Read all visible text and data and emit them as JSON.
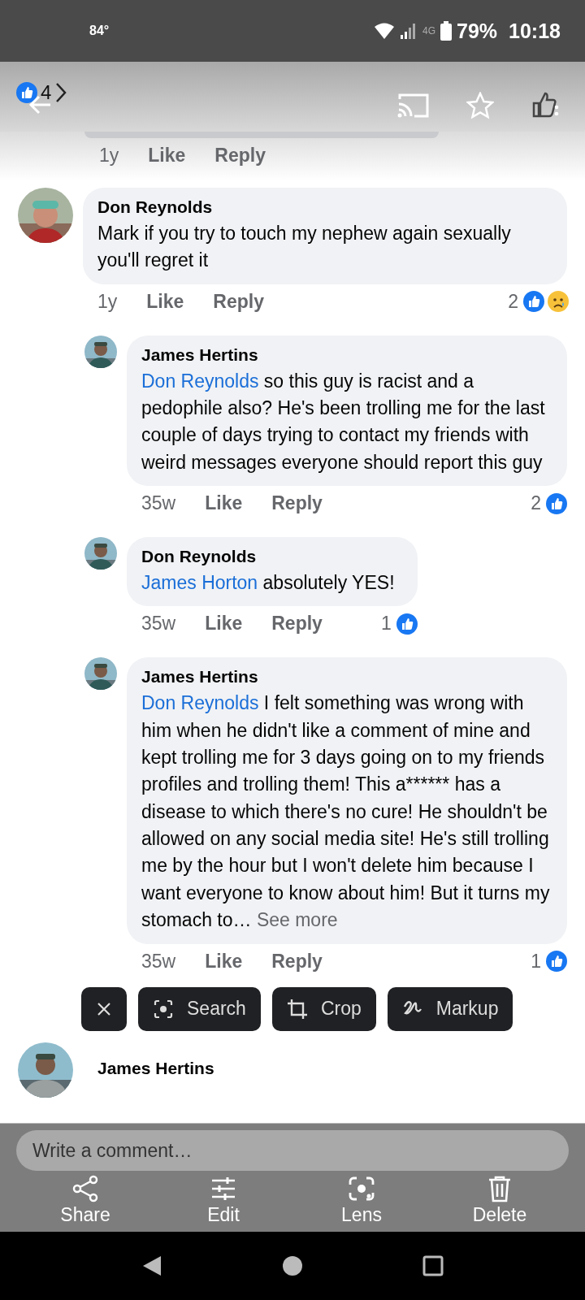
{
  "status_bar": {
    "temperature": "84°",
    "network": "4G",
    "battery": "79%",
    "time": "10:18"
  },
  "header": {
    "like_count": "4"
  },
  "previous_meta": {
    "time": "1y",
    "like": "Like",
    "reply": "Reply"
  },
  "comments": [
    {
      "author": "Don Reynolds",
      "text": "Mark if you try to touch my nephew again sexually you'll regret it",
      "time": "1y",
      "like": "Like",
      "reply": "Reply",
      "reaction_count": "2",
      "reactions": [
        {
          "kind": "like"
        },
        {
          "kind": "sad"
        }
      ],
      "children": [
        {
          "author": "James Hertins",
          "mention": "Don Reynolds",
          "text": "so this guy is racist and a pedophile also? He's been trolling me for the last couple of days trying to contact my friends with weird messages everyone should report this guy",
          "time": "35w",
          "like": "Like",
          "reply": "Reply",
          "reaction_count": "2",
          "reactions": [
            {
              "kind": "like"
            }
          ]
        },
        {
          "author": "Don Reynolds",
          "mention": "James Horton",
          "text": "absolutely YES!",
          "time": "35w",
          "like": "Like",
          "reply": "Reply",
          "reaction_count": "1",
          "reactions": [
            {
              "kind": "like"
            }
          ]
        },
        {
          "author": "James Hertins",
          "mention": "Don Reynolds",
          "text": "I felt something was wrong with him when he didn't like a comment of mine and kept trolling me for 3 days going on to my friends profiles and trolling them! This a****** has a disease to which there's no cure! He shouldn't be allowed on any social media site! He's still trolling me by the hour but I won't delete him because I want everyone to know about him! But it turns my stomach to…",
          "see_more": "See more",
          "time": "35w",
          "like": "Like",
          "reply": "Reply",
          "reaction_count": "1",
          "reactions": [
            {
              "kind": "like"
            }
          ]
        }
      ]
    }
  ],
  "screenshot_chips": [
    {
      "kind": "close"
    },
    {
      "kind": "search",
      "label": "Search"
    },
    {
      "kind": "crop",
      "label": "Crop"
    },
    {
      "kind": "markup",
      "label": "Markup"
    }
  ],
  "next_comment": {
    "author": "James Hertins"
  },
  "comment_field": {
    "placeholder": "Write a comment…"
  },
  "actions": [
    {
      "kind": "share",
      "label": "Share"
    },
    {
      "kind": "edit",
      "label": "Edit"
    },
    {
      "kind": "lens",
      "label": "Lens"
    },
    {
      "kind": "delete",
      "label": "Delete"
    }
  ]
}
